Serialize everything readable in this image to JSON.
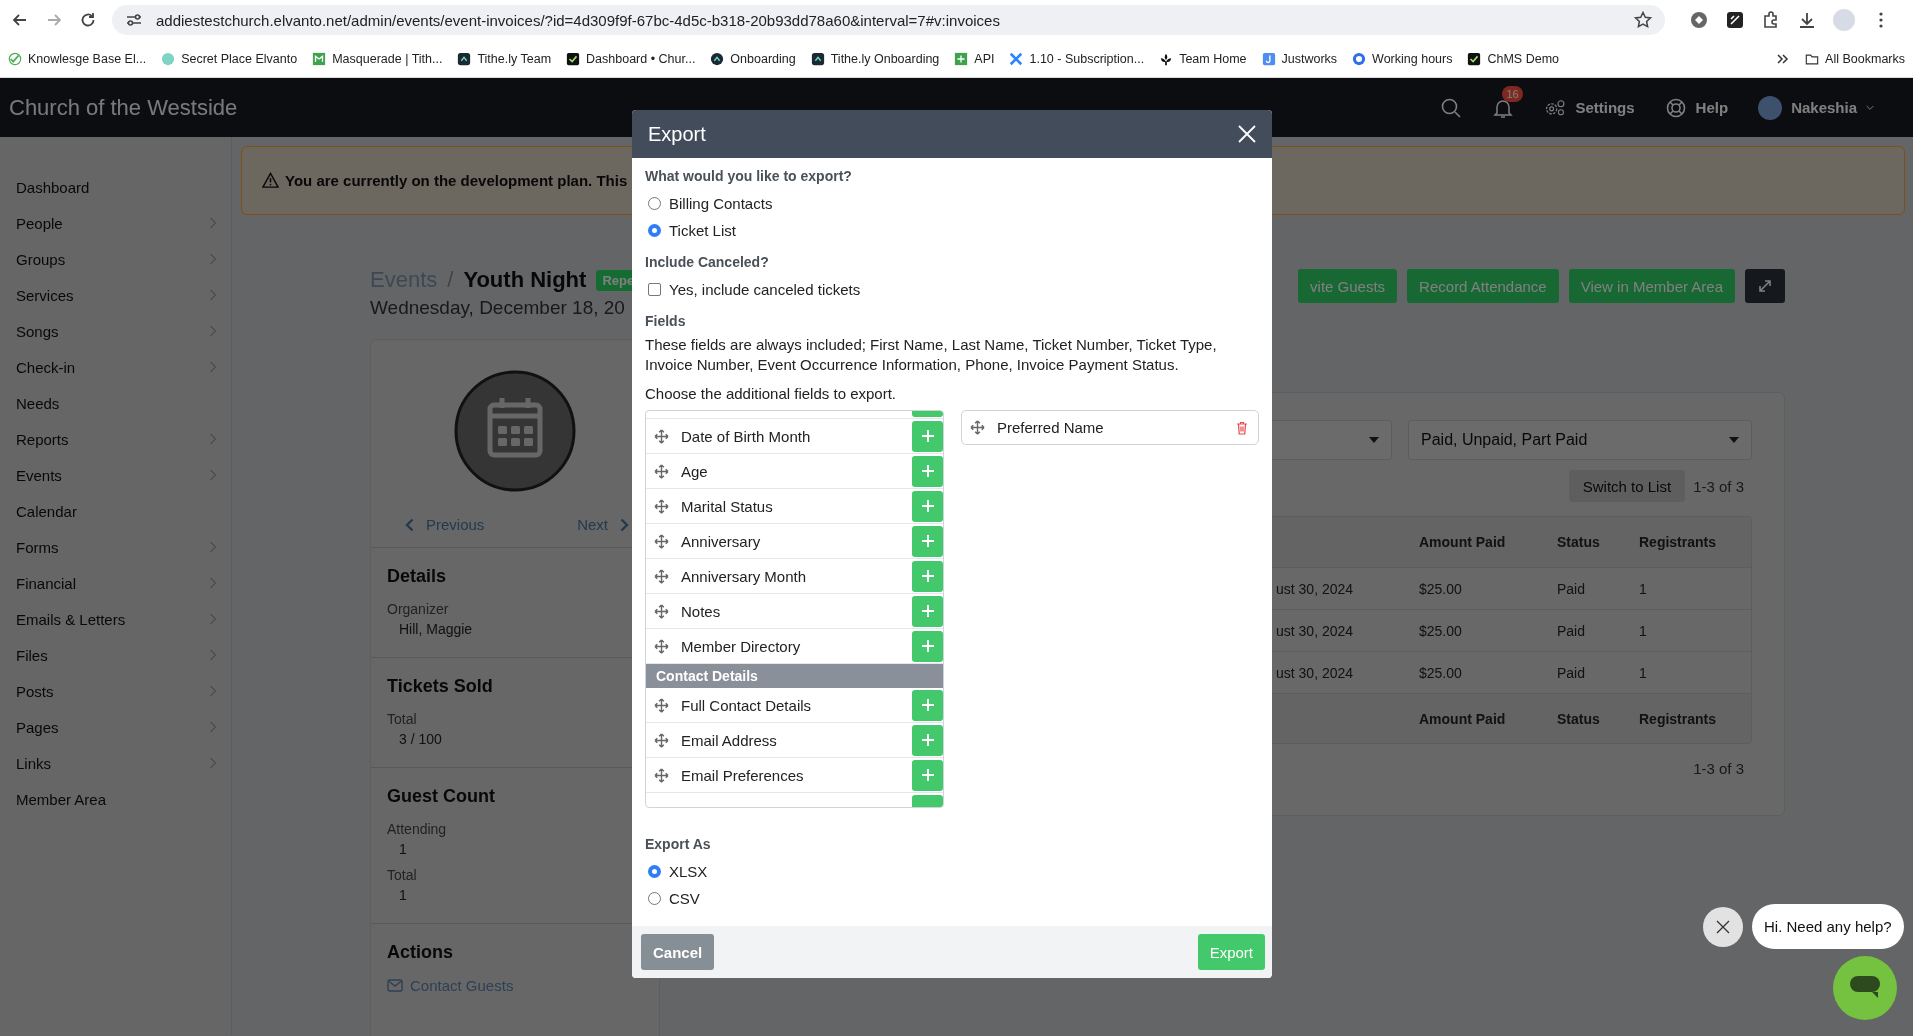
{
  "browser": {
    "url": "addiestestchurch.elvanto.net/admin/events/event-invoices/?id=4d309f9f-67bc-4d5c-b318-20b93dd78a60&interval=7#v:invoices",
    "bookmarks": [
      {
        "label": "Knowlesge Base El..."
      },
      {
        "label": "Secret Place Elvanto"
      },
      {
        "label": "Masquerade | Tith..."
      },
      {
        "label": "Tithe.ly Team"
      },
      {
        "label": "Dashboard • Chur..."
      },
      {
        "label": "Onboarding"
      },
      {
        "label": "Tithe.ly Onboarding"
      },
      {
        "label": "API"
      },
      {
        "label": "1.10 - Subscription..."
      },
      {
        "label": "Team Home"
      },
      {
        "label": "Justworks"
      },
      {
        "label": "Working hours"
      },
      {
        "label": "ChMS Demo"
      }
    ],
    "all_bookmarks": "All Bookmarks"
  },
  "app": {
    "brand": "Church of the Westside",
    "notification_count": "16",
    "settings": "Settings",
    "help": "Help",
    "user": "Nakeshia"
  },
  "sidebar": {
    "items": [
      {
        "label": "Dashboard",
        "has_submenu": false
      },
      {
        "label": "People",
        "has_submenu": true
      },
      {
        "label": "Groups",
        "has_submenu": true
      },
      {
        "label": "Services",
        "has_submenu": true
      },
      {
        "label": "Songs",
        "has_submenu": true
      },
      {
        "label": "Check-in",
        "has_submenu": true
      },
      {
        "label": "Needs",
        "has_submenu": false
      },
      {
        "label": "Reports",
        "has_submenu": true
      },
      {
        "label": "Events",
        "has_submenu": true
      },
      {
        "label": "Calendar",
        "has_submenu": false
      },
      {
        "label": "Forms",
        "has_submenu": true
      },
      {
        "label": "Financial",
        "has_submenu": true
      },
      {
        "label": "Emails & Letters",
        "has_submenu": true
      },
      {
        "label": "Files",
        "has_submenu": true
      },
      {
        "label": "Posts",
        "has_submenu": true
      },
      {
        "label": "Pages",
        "has_submenu": true
      },
      {
        "label": "Links",
        "has_submenu": true
      },
      {
        "label": "Member Area",
        "has_submenu": false
      }
    ]
  },
  "alert": "You are currently on the development plan. This",
  "event": {
    "breadcrumb_parent": "Events",
    "separator": "/",
    "title": "Youth Night",
    "badge": "Repe",
    "date": "Wednesday, December 18, 20",
    "previous": "Previous",
    "next": "Next",
    "sections": [
      {
        "heading": "Details",
        "entries": [
          {
            "label": "Organizer",
            "value": "Hill, Maggie"
          }
        ]
      },
      {
        "heading": "Tickets Sold",
        "entries": [
          {
            "label": "Total",
            "value": "3 / 100"
          }
        ]
      },
      {
        "heading": "Guest Count",
        "entries": [
          {
            "label": "Attending",
            "value": "1"
          },
          {
            "label": "Total",
            "value": "1"
          }
        ]
      },
      {
        "heading": "Actions"
      }
    ],
    "action_link": "Contact Guests",
    "buttons": [
      {
        "label": "vite Guests"
      },
      {
        "label": "Record Attendance"
      },
      {
        "label": "View in Member Area"
      }
    ]
  },
  "invoices": {
    "status_filter": "Paid, Unpaid, Part Paid",
    "switch_button": "Switch to List",
    "count_top": "1-3 of 3",
    "columns": [
      "Amount Paid",
      "Status",
      "Registrants"
    ],
    "rows": [
      {
        "column_1": "ust 30, 2024",
        "amount": "$25.00",
        "status": "Paid",
        "registrants": "1"
      },
      {
        "column_1": "ust 30, 2024",
        "amount": "$25.00",
        "status": "Paid",
        "registrants": "1"
      },
      {
        "column_1": "ust 30, 2024",
        "amount": "$25.00",
        "status": "Paid",
        "registrants": "1"
      }
    ],
    "footer_columns": [
      "Amount Paid",
      "Status",
      "Registrants"
    ],
    "count_bottom": "1-3 of 3"
  },
  "modal": {
    "title": "Export",
    "question": "What would you like to export?",
    "export_options": [
      {
        "label": "Billing Contacts",
        "selected": false
      },
      {
        "label": "Ticket List",
        "selected": true
      }
    ],
    "canceled_heading": "Include Canceled?",
    "canceled_option": {
      "label": "Yes, include canceled tickets",
      "checked": false
    },
    "fields_heading": "Fields",
    "always_text": "These fields are always included; First Name, Last Name, Ticket Number, Ticket Type, Invoice Number, Event Occurrence Information, Phone, Invoice Payment Status.",
    "choose_text": "Choose the additional fields to export.",
    "available_fields": [
      {
        "kind": "field",
        "label": "Date of Birth Month"
      },
      {
        "kind": "field",
        "label": "Age"
      },
      {
        "kind": "field",
        "label": "Marital Status"
      },
      {
        "kind": "field",
        "label": "Anniversary"
      },
      {
        "kind": "field",
        "label": "Anniversary Month"
      },
      {
        "kind": "field",
        "label": "Notes"
      },
      {
        "kind": "field",
        "label": "Member Directory"
      },
      {
        "kind": "group",
        "label": "Contact Details"
      },
      {
        "kind": "field",
        "label": "Full Contact Details"
      },
      {
        "kind": "field",
        "label": "Email Address"
      },
      {
        "kind": "field",
        "label": "Email Preferences"
      }
    ],
    "selected_fields": [
      {
        "label": "Preferred Name"
      }
    ],
    "export_as_heading": "Export As",
    "formats": [
      {
        "label": "XLSX",
        "selected": true
      },
      {
        "label": "CSV",
        "selected": false
      }
    ],
    "cancel": "Cancel",
    "export": "Export"
  },
  "chat": {
    "message": "Hi. Need any help?"
  }
}
